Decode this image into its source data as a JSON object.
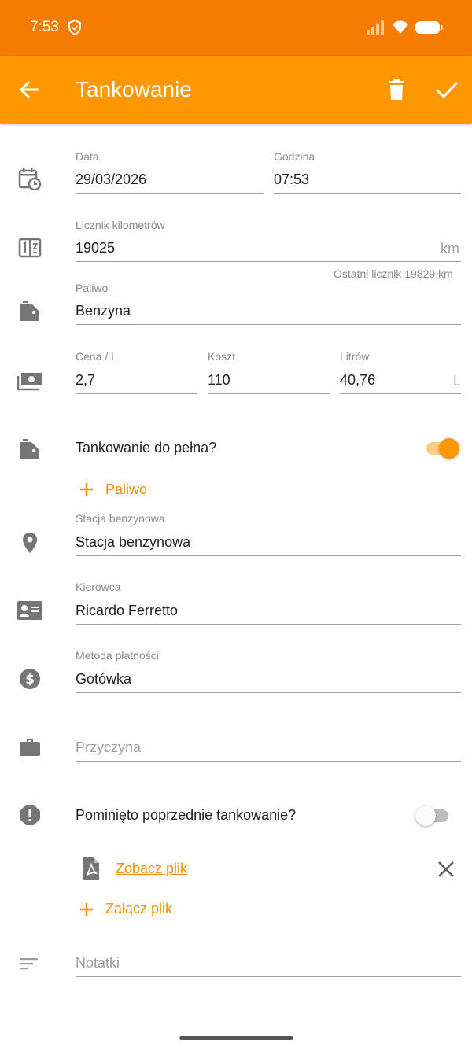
{
  "status_bar": {
    "time": "7:53"
  },
  "app_bar": {
    "title": "Tankowanie",
    "back_icon": "arrow-left-icon",
    "delete_icon": "trash-icon",
    "confirm_icon": "checkmark-icon",
    "color": "#ff9800"
  },
  "form": {
    "date": {
      "label": "Data",
      "value": "29/03/2026"
    },
    "time": {
      "label": "Godzina",
      "value": "07:53"
    },
    "odometer": {
      "label": "Licznik kilometrów",
      "value": "19025",
      "unit": "km",
      "hint": "Ostatni licznik 19829 km"
    },
    "fuel": {
      "label": "Paliwo",
      "value": "Benzyna"
    },
    "price": {
      "label": "Cena / L",
      "value": "2,7"
    },
    "cost": {
      "label": "Koszt",
      "value": "110"
    },
    "liters": {
      "label": "Litrów",
      "value": "40,76",
      "unit": "L"
    },
    "full_tank": {
      "label": "Tankowanie do pełna?",
      "on": true
    },
    "add_fuel": {
      "label": "Paliwo"
    },
    "station": {
      "label": "Stacja benzynowa",
      "value": "Stacja benzynowa"
    },
    "driver": {
      "label": "Kierowca",
      "value": "Ricardo Ferretto"
    },
    "payment": {
      "label": "Metoda płatności",
      "value": "Gotówka"
    },
    "reason": {
      "placeholder": "Przyczyna"
    },
    "missed_previous": {
      "label": "Pominięto poprzednie tankowanie?",
      "on": false
    },
    "attachment": {
      "label": "Zobacz plik"
    },
    "attach_file": {
      "label": "Załącz plik"
    },
    "notes": {
      "placeholder": "Notatki"
    }
  },
  "accent_color": "#f29100"
}
